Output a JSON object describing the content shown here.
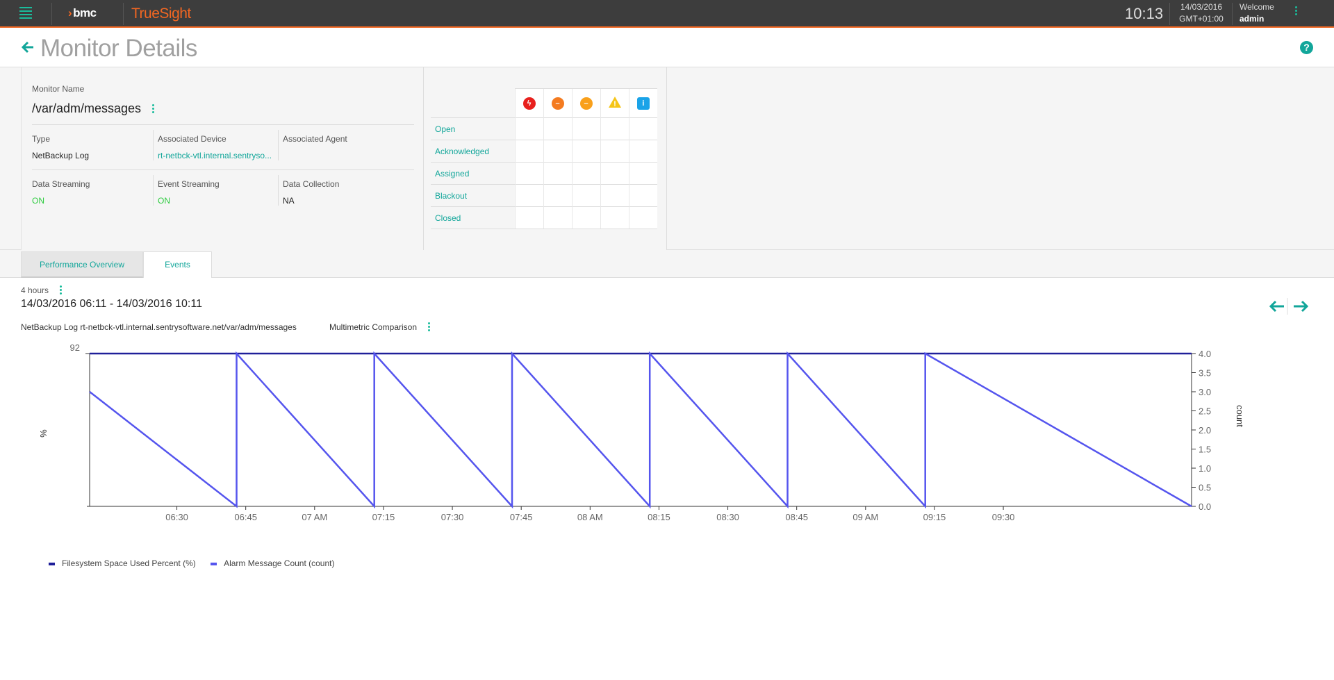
{
  "topbar": {
    "brand": "bmc",
    "product": "TrueSight",
    "time": "10:13",
    "date": "14/03/2016",
    "timezone": "GMT+01:00",
    "welcome": "Welcome",
    "user": "admin",
    "accent": "#f26722"
  },
  "page": {
    "title": "Monitor Details"
  },
  "monitor": {
    "name_label": "Monitor Name",
    "name": "/var/adm/messages",
    "type_label": "Type",
    "type": "NetBackup Log",
    "device_label": "Associated Device",
    "device": "rt-netbck-vtl.internal.sentryso...",
    "agent_label": "Associated Agent",
    "agent": "",
    "data_streaming_label": "Data Streaming",
    "data_streaming": "ON",
    "event_streaming_label": "Event Streaming",
    "event_streaming": "ON",
    "data_collection_label": "Data Collection",
    "data_collection": "NA"
  },
  "severity": {
    "icons": [
      {
        "name": "critical-icon",
        "color": "#e8201d",
        "glyph": "ϟ"
      },
      {
        "name": "major-icon",
        "color": "#f47b20",
        "glyph": "–"
      },
      {
        "name": "minor-icon",
        "color": "#f9a01b",
        "glyph": "–"
      },
      {
        "name": "warning-icon",
        "color": "#f5c518",
        "glyph": "!"
      },
      {
        "name": "info-icon",
        "color": "#1aa3e8",
        "glyph": "i"
      }
    ],
    "rows": [
      "Open",
      "Acknowledged",
      "Assigned",
      "Blackout",
      "Closed"
    ]
  },
  "tabs": {
    "performance": "Performance Overview",
    "events": "Events"
  },
  "perf": {
    "range": "4 hours",
    "dates": "14/03/2016 06:11 - 14/03/2016 10:11",
    "series_title": "NetBackup Log rt-netbck-vtl.internal.sentrysoftware.net/var/adm/messages",
    "comparison": "Multimetric Comparison"
  },
  "chart_data": {
    "type": "line",
    "left_axis": {
      "label": "%",
      "ticks": [
        "92"
      ],
      "max": 92
    },
    "right_axis": {
      "label": "count",
      "ylim": [
        0,
        4
      ],
      "ticks": [
        "4.0",
        "3.5",
        "3.0",
        "2.5",
        "2.0",
        "1.5",
        "1.0",
        "0.5",
        "0.0"
      ]
    },
    "x_ticks": [
      "06:30",
      "06:45",
      "07 AM",
      "07:15",
      "07:30",
      "07:45",
      "08 AM",
      "08:15",
      "08:30",
      "08:45",
      "09 AM",
      "09:15",
      "09:30"
    ],
    "x_range": [
      "06:11",
      "10:11"
    ],
    "series": [
      {
        "name": "Filesystem Space Used Percent (%)",
        "color": "#1f1f99",
        "axis": "left",
        "points": [
          [
            "06:11",
            92
          ],
          [
            "10:11",
            92
          ]
        ]
      },
      {
        "name": "Alarm Message Count (count)",
        "color": "#5555ee",
        "axis": "right",
        "points": [
          [
            "06:11",
            3.0
          ],
          [
            "06:43",
            0.0
          ],
          [
            "06:43",
            4.0
          ],
          [
            "07:13",
            0.0
          ],
          [
            "07:13",
            4.0
          ],
          [
            "07:43",
            0.0
          ],
          [
            "07:43",
            4.0
          ],
          [
            "08:13",
            0.0
          ],
          [
            "08:13",
            4.0
          ],
          [
            "08:43",
            0.0
          ],
          [
            "08:43",
            4.0
          ],
          [
            "09:13",
            0.0
          ],
          [
            "09:13",
            4.0
          ],
          [
            "10:11",
            0.0
          ]
        ]
      }
    ]
  }
}
